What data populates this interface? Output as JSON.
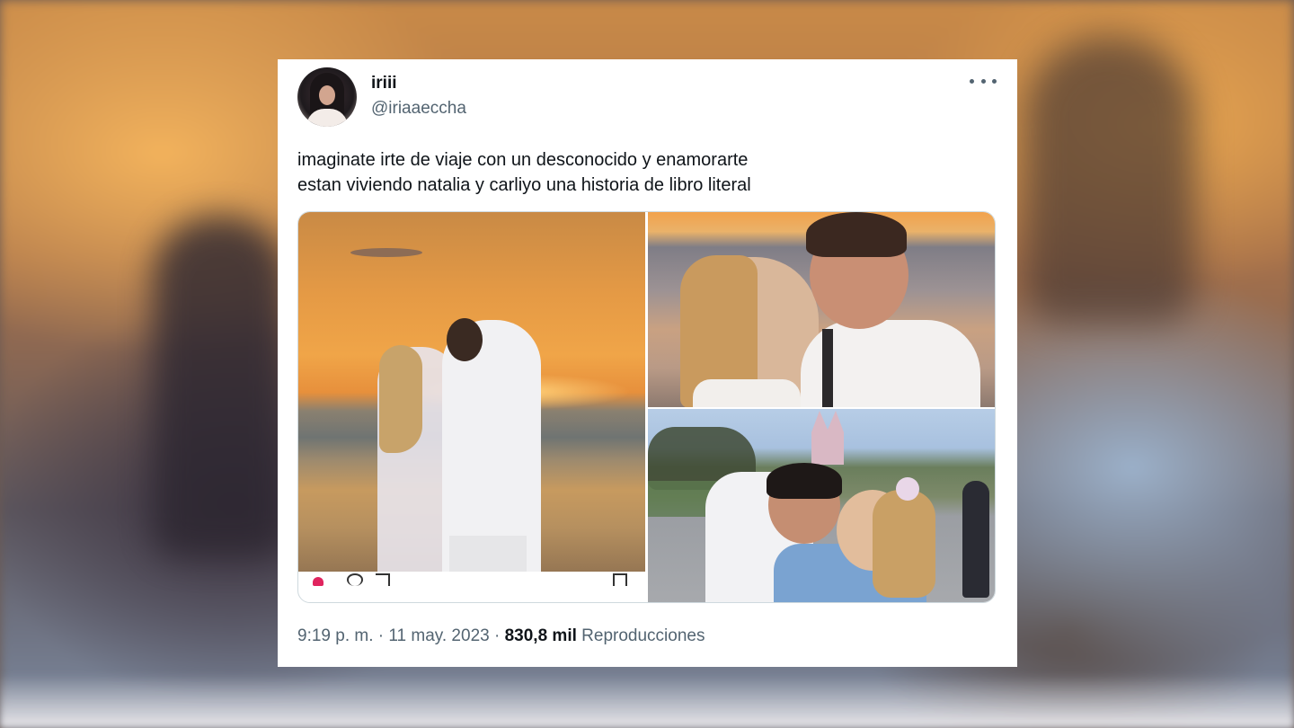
{
  "tweet": {
    "author": {
      "display_name": "iriii",
      "handle": "@iriaaeccha"
    },
    "text_lines": [
      "imaginate irte de viaje con un desconocido y enamorarte",
      "estan viviendo natalia y carliyo una historia de libro literal"
    ],
    "media_count": 3,
    "meta": {
      "time": "9:19 p. m.",
      "separator": "·",
      "date": "11 may. 2023",
      "views_count": "830,8 mil",
      "views_label": "Reproducciones"
    },
    "more_icon": "more-horizontal-icon"
  },
  "colors": {
    "text_primary": "#0f1419",
    "text_secondary": "#536471",
    "card_background": "#ffffff",
    "media_border": "#cfd9de"
  }
}
